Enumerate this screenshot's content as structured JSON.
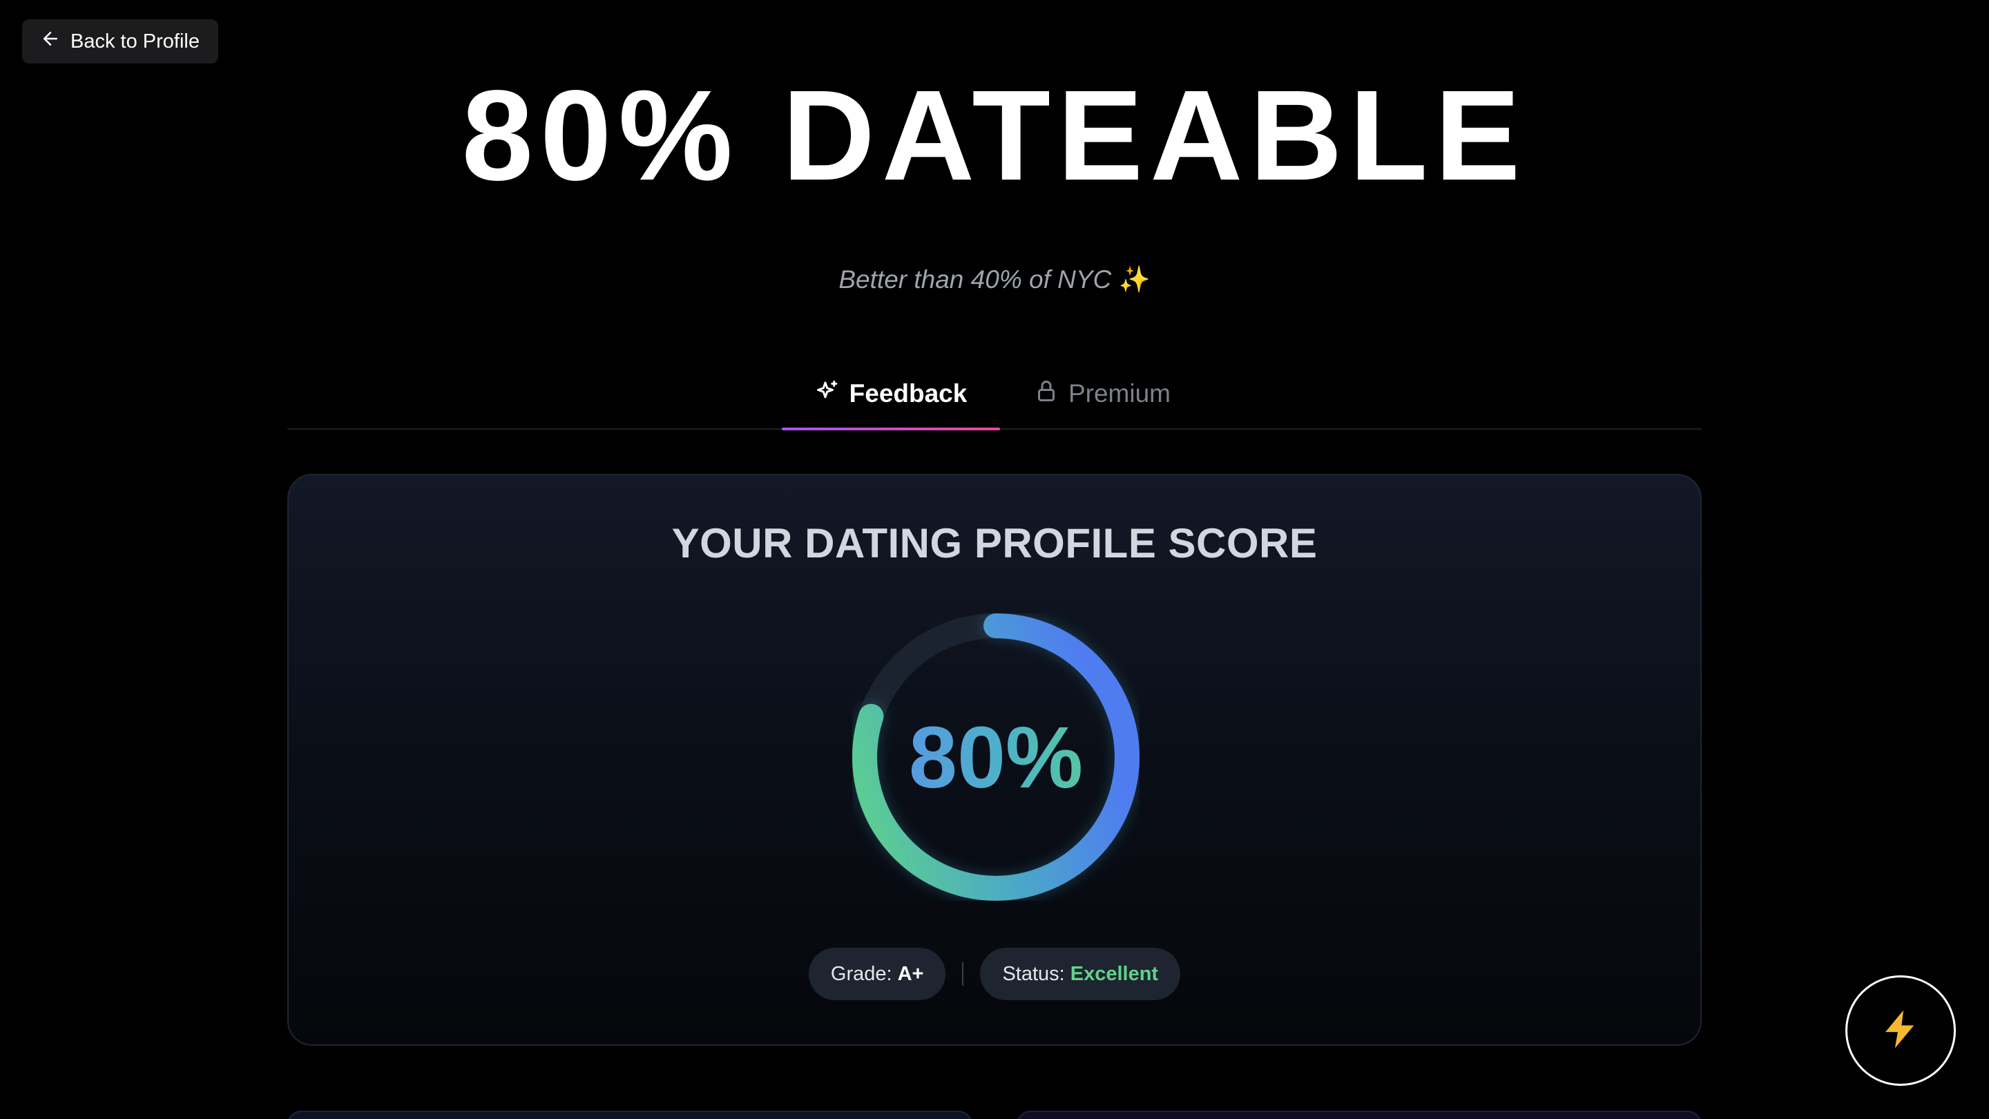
{
  "nav": {
    "back_label": "Back to Profile"
  },
  "hero": {
    "title": "80% DATEABLE",
    "subtitle": "Better than 40% of NYC",
    "subtitle_emoji": "✨"
  },
  "tabs": [
    {
      "label": "Feedback",
      "icon": "sparkle-icon",
      "active": true
    },
    {
      "label": "Premium",
      "icon": "lock-icon",
      "active": false
    }
  ],
  "score_card": {
    "title": "YOUR DATING PROFILE SCORE",
    "score_display": "80%",
    "score_fraction": 0.8,
    "grade_label": "Grade:",
    "grade_value": "A+",
    "status_label": "Status:",
    "status_value": "Excellent"
  },
  "fab": {
    "icon": "lightning-icon"
  },
  "colors": {
    "background": "#000000",
    "tab_accent_start": "#a855f7",
    "tab_accent_end": "#ec4899",
    "gauge_green": "#5fd38a",
    "gauge_blue": "#4f7df0",
    "status_green": "#5fd38a",
    "lightning": "#f5b82e"
  }
}
